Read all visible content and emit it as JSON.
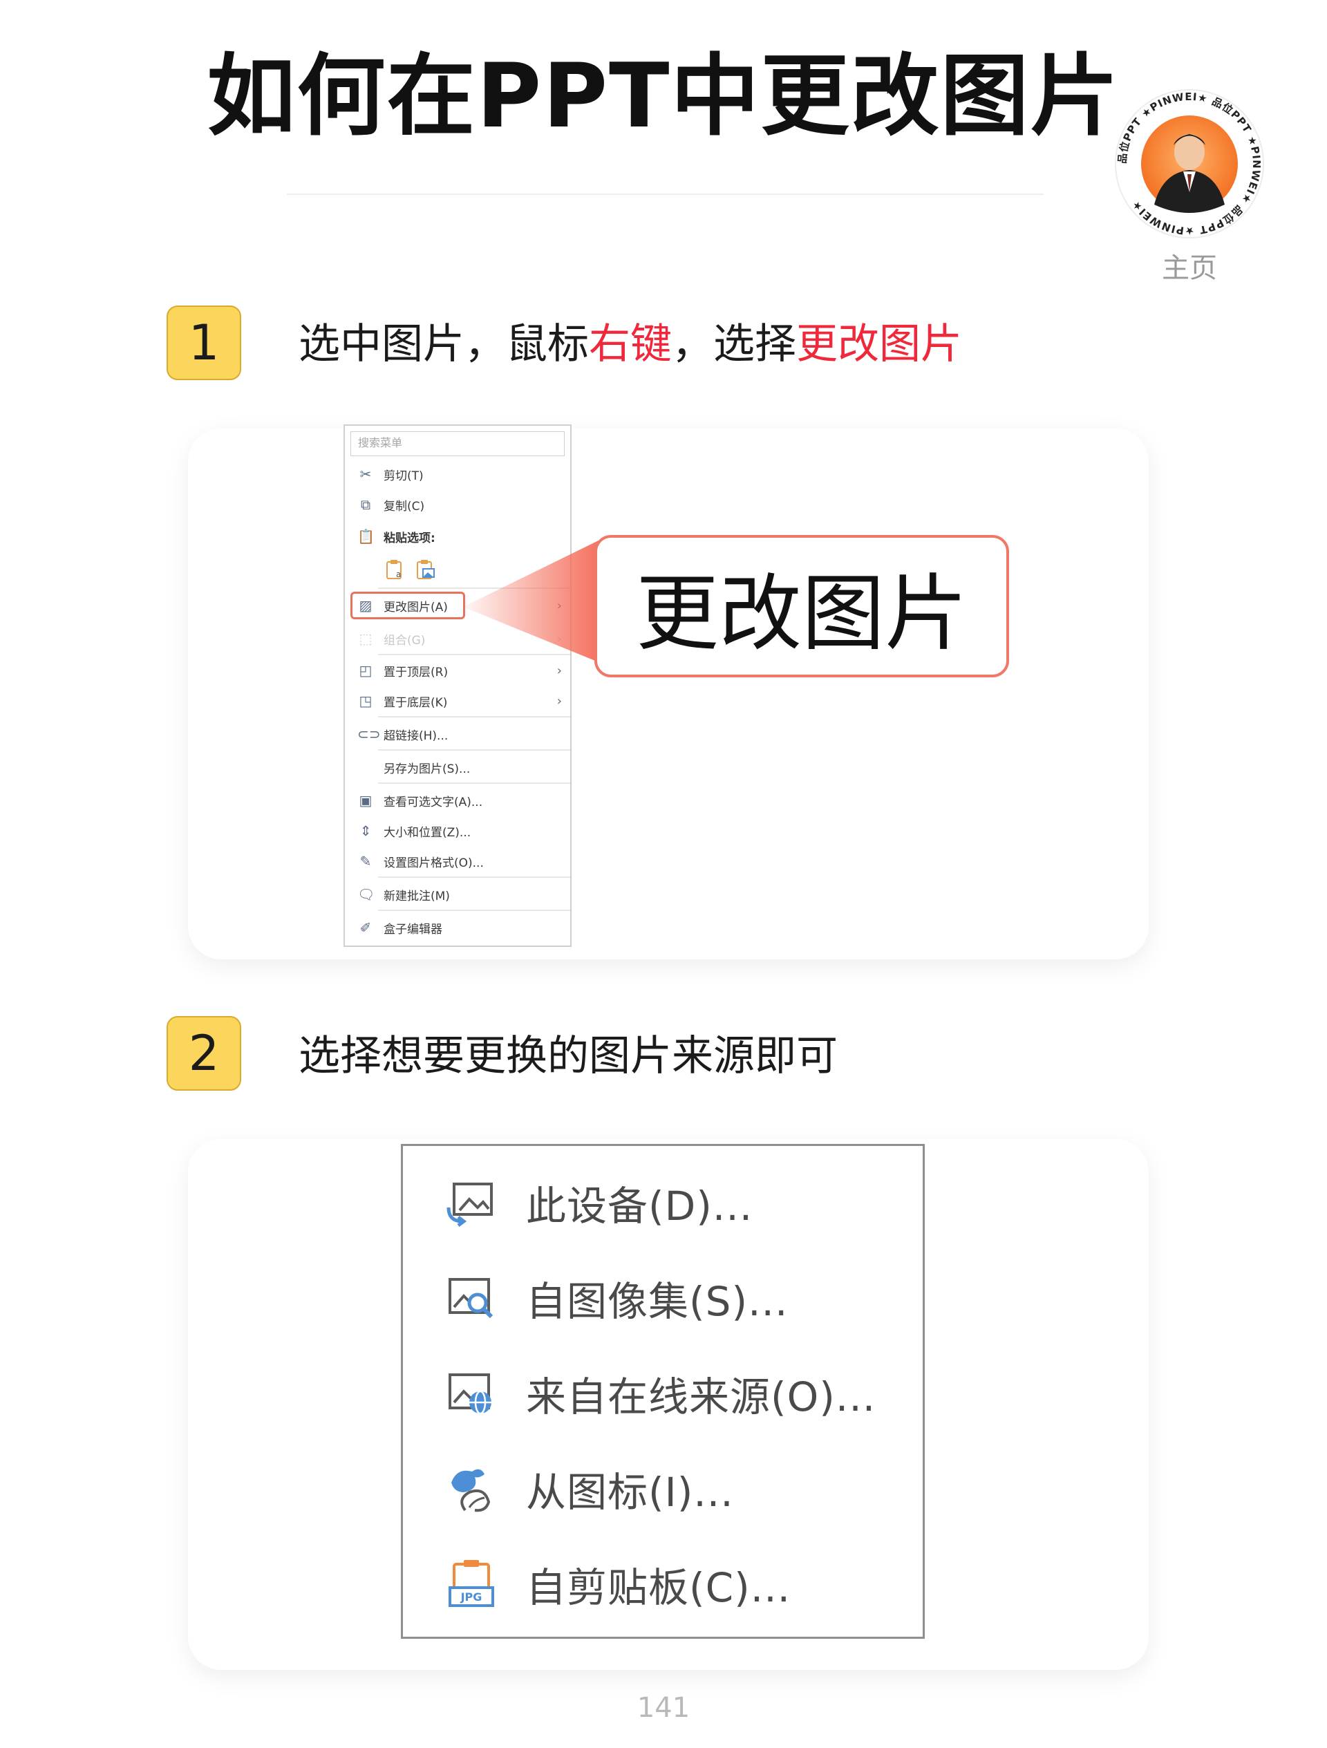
{
  "header": {
    "title": "如何在PPT中更改图片",
    "badge_ring_text": "品位PPT ★PINWEI★ 品位PPT ★PINWEI★ 品位PPT ★PINWEI★",
    "home_label": "主页"
  },
  "steps": [
    {
      "number": "1",
      "text_parts": [
        "选中图片，鼠标",
        "右键",
        "，选择",
        "更改图片"
      ]
    },
    {
      "number": "2",
      "text": "选择想要更换的图片来源即可"
    }
  ],
  "context_menu": {
    "search_placeholder": "搜索菜单",
    "items": [
      {
        "label": "剪切(T)",
        "icon": "scissors-icon"
      },
      {
        "label": "复制(C)",
        "icon": "copy-icon"
      },
      {
        "label": "粘贴选项:",
        "icon": "paste-icon"
      },
      {
        "label": "更改图片(A)",
        "icon": "change-picture-icon",
        "submenu": true
      },
      {
        "label": "组合(G)",
        "icon": "group-icon",
        "submenu": true,
        "disabled": true
      },
      {
        "label": "置于顶层(R)",
        "icon": "bring-front-icon",
        "submenu": true
      },
      {
        "label": "置于底层(K)",
        "icon": "send-back-icon",
        "submenu": true
      },
      {
        "label": "超链接(H)...",
        "icon": "link-icon"
      },
      {
        "label": "另存为图片(S)...",
        "icon": ""
      },
      {
        "label": "查看可选文字(A)...",
        "icon": "alt-text-icon"
      },
      {
        "label": "大小和位置(Z)...",
        "icon": "size-position-icon"
      },
      {
        "label": "设置图片格式(O)...",
        "icon": "format-picture-icon"
      },
      {
        "label": "新建批注(M)",
        "icon": "comment-icon"
      },
      {
        "label": "盒子编辑器",
        "icon": "edit-icon"
      }
    ]
  },
  "callout": {
    "text": "更改图片"
  },
  "source_menu": {
    "items": [
      {
        "label": "此设备(D)...",
        "icon": "device-image-icon"
      },
      {
        "label": "自图像集(S)...",
        "icon": "image-search-icon"
      },
      {
        "label": "来自在线来源(O)...",
        "icon": "online-image-icon"
      },
      {
        "label": "从图标(I)...",
        "icon": "icon-shapes-icon"
      },
      {
        "label": "自剪贴板(C)...",
        "icon": "clipboard-jpg-icon"
      }
    ]
  },
  "footer": {
    "page_number": "141"
  },
  "colors": {
    "accent_red": "#f0283c",
    "step_badge": "#fcd55c",
    "callout_border": "#f07866",
    "icon_blue": "#4c8fd6",
    "icon_orange": "#f08a3c"
  }
}
